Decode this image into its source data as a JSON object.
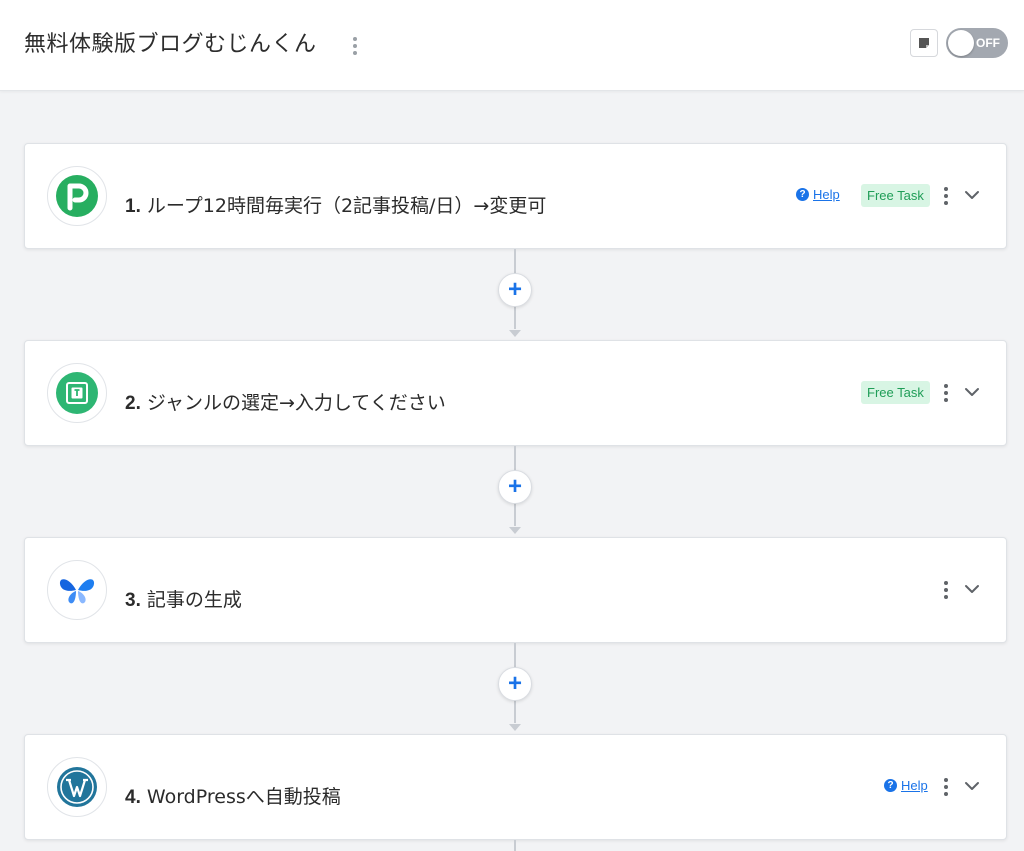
{
  "header": {
    "flow_title": "無料体験版ブログむじんくん",
    "toggle_label": "OFF",
    "icons": {
      "more": "kebab-icon",
      "memo": "memo-icon"
    }
  },
  "steps": [
    {
      "number": "1.",
      "name": "ループ12時間毎実行（2記事投稿/日）→変更可",
      "icon": "pabbly-p-icon",
      "icon_color": "#27ae60",
      "help_label": "Help",
      "badge": "Free Task"
    },
    {
      "number": "2.",
      "name": "ジャンルの選定→入力してください",
      "icon": "text-input-icon",
      "icon_color": "#2eb673",
      "badge": "Free Task"
    },
    {
      "number": "3.",
      "name": "記事の生成",
      "icon": "butterfly-icon",
      "icon_color": "#1565e0"
    },
    {
      "number": "4.",
      "name": "WordPressへ自動投稿",
      "icon": "wordpress-icon",
      "icon_color": "#21759b",
      "help_label": "Help"
    }
  ],
  "add_button_label": "+",
  "colors": {
    "accent": "#1a73e8",
    "badge_bg": "#d8f5e4",
    "badge_text": "#1f9d57",
    "canvas_bg": "#f2f3f5"
  }
}
